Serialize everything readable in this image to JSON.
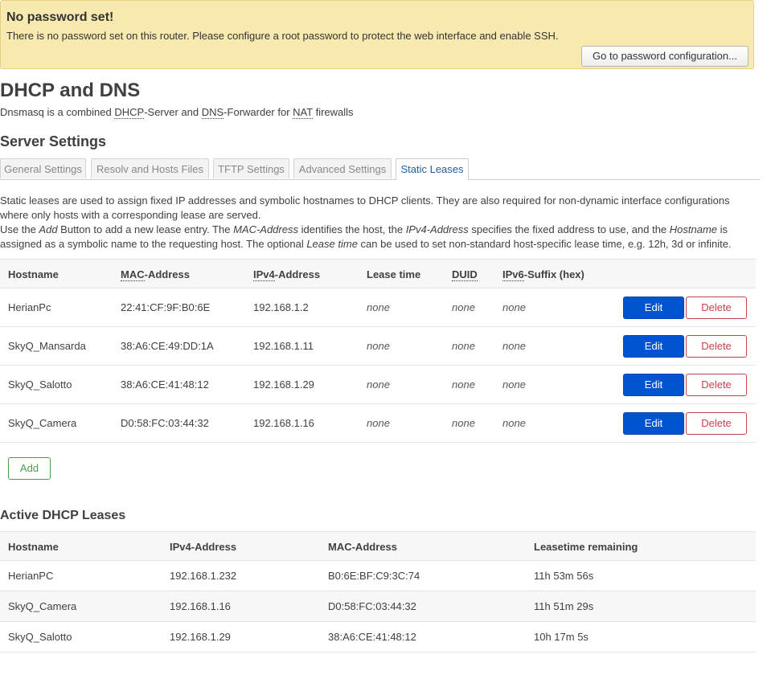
{
  "alert": {
    "title": "No password set!",
    "message": "There is no password set on this router. Please configure a root password to protect the web interface and enable SSH.",
    "button_label": "Go to password configuration..."
  },
  "page": {
    "title": "DHCP and DNS",
    "desc_pre": "Dnsmasq is a combined ",
    "desc_dhcp": "DHCP",
    "desc_mid1": "-Server and ",
    "desc_dns": "DNS",
    "desc_mid2": "-Forwarder for ",
    "desc_nat": "NAT",
    "desc_post": " firewalls"
  },
  "section": {
    "title": "Server Settings"
  },
  "tabs": [
    {
      "label": "General Settings"
    },
    {
      "label": "Resolv and Hosts Files"
    },
    {
      "label": "TFTP Settings"
    },
    {
      "label": "Advanced Settings"
    },
    {
      "label": "Static Leases"
    }
  ],
  "intro": {
    "p1": "Static leases are used to assign fixed IP addresses and symbolic hostnames to DHCP clients. They are also required for non-dynamic interface configurations where only hosts with a corresponding lease are served.",
    "p2_a": "Use the ",
    "p2_b": "Add",
    "p2_c": " Button to add a new lease entry. The ",
    "p2_d": "MAC-Address",
    "p2_e": " identifies the host, the ",
    "p2_f": "IPv4-Address",
    "p2_g": " specifies the fixed address to use, and the ",
    "p2_h": "Hostname",
    "p2_i": " is assigned as a symbolic name to the requesting host. The optional ",
    "p2_j": "Lease time",
    "p2_k": " can be used to set non-standard host-specific lease time, e.g. 12h, 3d or infinite."
  },
  "static_table": {
    "headers": {
      "hostname": "Hostname",
      "mac_abbr": "MAC",
      "mac_rest": "-Address",
      "ipv4_abbr": "IPv4",
      "ipv4_rest": "-Address",
      "lease": "Lease time",
      "duid": "DUID",
      "ipv6_abbr": "IPv6",
      "ipv6_rest": "-Suffix (hex)"
    },
    "rows": [
      {
        "hostname": "HerianPc",
        "mac": "22:41:CF:9F:B0:6E",
        "ip": "192.168.1.2",
        "lease": "none",
        "duid": "none",
        "ipv6": "none"
      },
      {
        "hostname": "SkyQ_Mansarda",
        "mac": "38:A6:CE:49:DD:1A",
        "ip": "192.168.1.11",
        "lease": "none",
        "duid": "none",
        "ipv6": "none"
      },
      {
        "hostname": "SkyQ_Salotto",
        "mac": "38:A6:CE:41:48:12",
        "ip": "192.168.1.29",
        "lease": "none",
        "duid": "none",
        "ipv6": "none"
      },
      {
        "hostname": "SkyQ_Camera",
        "mac": "D0:58:FC:03:44:32",
        "ip": "192.168.1.16",
        "lease": "none",
        "duid": "none",
        "ipv6": "none"
      }
    ],
    "edit_label": "Edit",
    "delete_label": "Delete",
    "add_label": "Add"
  },
  "active": {
    "title": "Active DHCP Leases",
    "headers": {
      "hostname": "Hostname",
      "ipv4": "IPv4-Address",
      "mac": "MAC-Address",
      "remaining": "Leasetime remaining"
    },
    "rows": [
      {
        "hostname": "HerianPC",
        "ip": "192.168.1.232",
        "mac": "B0:6E:BF:C9:3C:74",
        "remaining": "11h 53m 56s"
      },
      {
        "hostname": "SkyQ_Camera",
        "ip": "192.168.1.16",
        "mac": "D0:58:FC:03:44:32",
        "remaining": "11h 51m 29s"
      },
      {
        "hostname": "SkyQ_Salotto",
        "ip": "192.168.1.29",
        "mac": "38:A6:CE:41:48:12",
        "remaining": "10h 17m 5s"
      }
    ]
  },
  "colors": {
    "alert_bg": "#f8e9b0",
    "edit_button": "#0054d0",
    "delete_button": "#c8434b",
    "add_button": "#4a9e4a",
    "active_tab_text": "#1f5ea8"
  }
}
